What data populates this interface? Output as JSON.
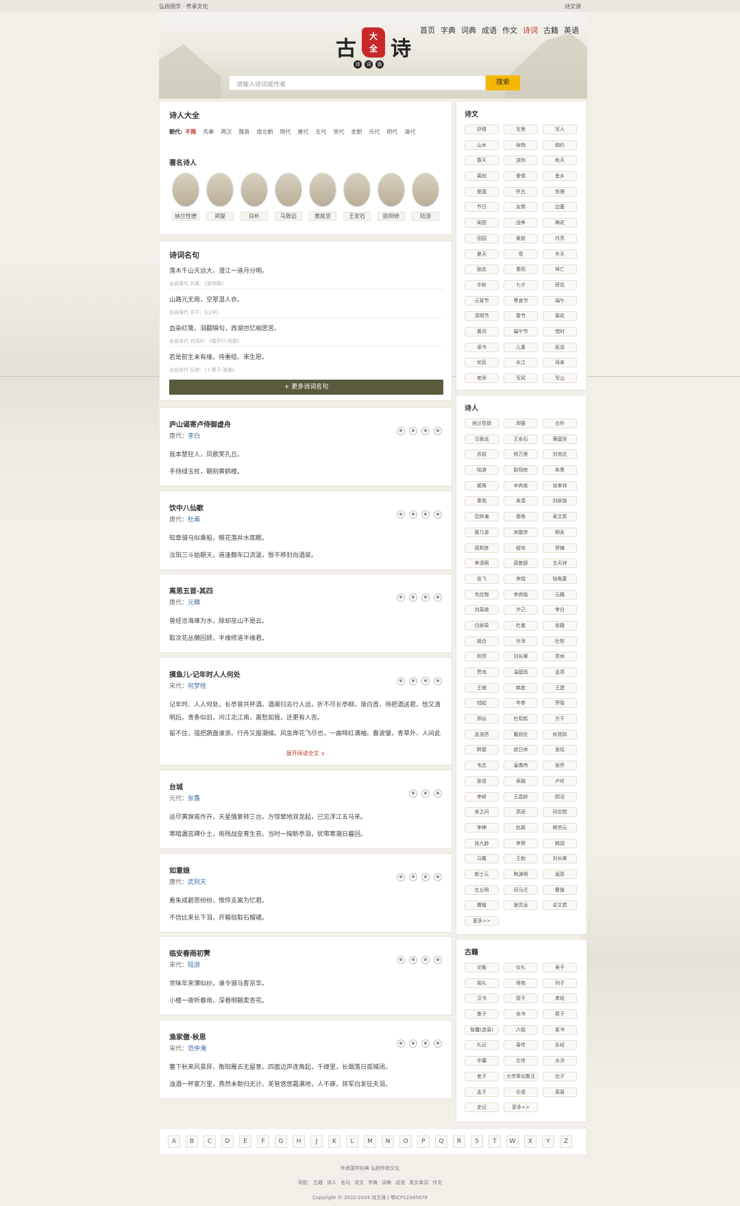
{
  "topbar": {
    "left": "弘扬国学 · 传承文化",
    "right": "诗文驿"
  },
  "nav": [
    "首页",
    "字典",
    "词典",
    "成语",
    "作文",
    "诗词",
    "古籍",
    "英语"
  ],
  "nav_active": 5,
  "logo": {
    "left": "古",
    "right": "诗",
    "seal_top": "大",
    "seal_bottom": "全",
    "sub": [
      "诗",
      "词",
      "曲"
    ]
  },
  "search": {
    "placeholder": "请输入诗词或作者",
    "button": "搜索"
  },
  "poets_card": {
    "title": "诗人大全",
    "dynasty_label": "朝代:",
    "dynasties": [
      "不限",
      "先秦",
      "两汉",
      "魏晋",
      "南北朝",
      "隋代",
      "唐代",
      "五代",
      "宋代",
      "金朝",
      "元代",
      "明代",
      "清代"
    ],
    "famous_title": "著名诗人",
    "famous": [
      "纳兰性德",
      "郑燮",
      "白朴",
      "马致远",
      "黄庭坚",
      "王安石",
      "欧阳修",
      "陆游"
    ]
  },
  "quotes_card": {
    "title": "诗词名句",
    "items": [
      {
        "text": "落木千山天远大，澄江一道月分明。",
        "source": "出自唐代 刘禹：《登快阁》"
      },
      {
        "text": "山路元无雨，空翠湿人衣。",
        "source": "出自唐代 方干：《山中》"
      },
      {
        "text": "血染红笺，泪翻锦句，西湖岂忆相思苦。",
        "source": "出自宋代 刘鸿孙：《踏莎行·闲游》"
      },
      {
        "text": "若是前生未有缘，待重结、来生愿。",
        "source": "出自宋代 乐婉：《卜算子·答施》"
      }
    ],
    "more": "+ 更多诗词名句"
  },
  "poems": [
    {
      "title": "庐山谣寄卢侍御虚舟",
      "dynasty": "唐代：",
      "author": "李白",
      "lines": [
        "我本楚狂人，凤歌笑孔丘。",
        "手持绿玉杖，朝别黄鹤楼。"
      ]
    },
    {
      "title": "饮中八仙歌",
      "dynasty": "唐代：",
      "author": "杜甫",
      "lines": [
        "知章骑马似乘船，眼花落井水底眠。",
        "汝阳三斗始朝天，道逢麴车口流涎，恨不移封向酒泉。"
      ]
    },
    {
      "title": "离思五首·其四",
      "dynasty": "唐代：",
      "author": "元稹",
      "lines": [
        "曾经沧海难为水，除却巫山不是云。",
        "取次花丛懒回顾，半缘修道半缘君。"
      ]
    },
    {
      "title": "摸鱼儿·记年时人人何处",
      "dynasty": "宋代：",
      "author": "何梦桂",
      "lines": [
        "记年时、人人何处，长亭曾共杯酒。酒阑归去行人远，折不尽长亭柳。渐白首，待把酒送君，恰又清明后。青条似旧，问江北江南，离愁如我，还更有人否。",
        "留不住，强把蔬盘谁浙。行舟又报潮候。风急岸花飞尽也，一曲啼红满袖。春波皱，青草外、人间此"
      ],
      "unfold": "展开阅读全文 ∨"
    },
    {
      "title": "台城",
      "dynasty": "元代：",
      "author": "张翥",
      "lines": [
        "运尽黄旗竟作开，天星俄复转三台。方惊辇地双龙起，已见浮江五马来。",
        "寒暗漏宫碑仆土，雨残战垒育生苔。当时一掬新亭泪，犹带寒潮日暮回。"
      ]
    },
    {
      "title": "如意娘",
      "dynasty": "唐代：",
      "author": "武则天",
      "lines": [
        "看朱成碧思纷纷，憔悴支离为忆君。",
        "不信比来长下泪，开箱验取石榴裙。"
      ]
    },
    {
      "title": "临安春雨初霁",
      "dynasty": "宋代：",
      "author": "陆游",
      "lines": [
        "世味年来薄似纱，谁令骑马客京华。",
        "小楼一夜听春雨，深巷明朝卖杏花。"
      ]
    },
    {
      "title": "渔家傲·秋思",
      "dynasty": "宋代：",
      "author": "范仲淹",
      "lines": [
        "塞下秋来风景异，衡阳雁去无留意。四面边声连角起，千嶂里，长烟落日孤城闭。",
        "浊酒一杯家万里，燕然未勒归无计。羌管悠悠霜满地，人不寐，将军白发征夫泪。"
      ]
    }
  ],
  "shiwen": {
    "title": "诗文",
    "tags": [
      "抒情",
      "写景",
      "写人",
      "山水",
      "咏物",
      "婉约",
      "春天",
      "送别",
      "秋天",
      "离别",
      "爱情",
      "思乡",
      "爱国",
      "怀古",
      "哲理",
      "节日",
      "友情",
      "边塞",
      "闺怨",
      "战争",
      "梅花",
      "田园",
      "豪放",
      "月亮",
      "夏天",
      "雪",
      "冬天",
      "励志",
      "重阳",
      "悼亡",
      "中秋",
      "七夕",
      "荷花",
      "元宵节",
      "寒食节",
      "端午",
      "清明节",
      "春节",
      "菊花",
      "黄河",
      "端午节",
      "惜时",
      "读书",
      "儿童",
      "民谣",
      "忧民",
      "长江",
      "母亲",
      "老师",
      "写风",
      "写山"
    ]
  },
  "shiren": {
    "title": "诗人",
    "tags": [
      "纳兰性德",
      "郑燮",
      "白朴",
      "马致远",
      "王安石",
      "黄庭坚",
      "苏轼",
      "杨万里",
      "刘克庄",
      "陆游",
      "欧阳修",
      "朱熹",
      "晏殊",
      "辛弃疾",
      "张孝祥",
      "秦观",
      "吴潜",
      "刘辰翁",
      "范仲淹",
      "晏殊",
      "吴文英",
      "晏几道",
      "宋徽宗",
      "柳永",
      "周邦彦",
      "程垓",
      "贺铸",
      "李清照",
      "周敦颐",
      "文天祥",
      "岳飞",
      "李煜",
      "陆龟蒙",
      "韦应物",
      "李商隐",
      "元稹",
      "刘禹锡",
      "齐己",
      "李白",
      "白居易",
      "杜甫",
      "张籍",
      "姚合",
      "许浑",
      "杜牧",
      "皎然",
      "刘长卿",
      "贯休",
      "贾岛",
      "温庭筠",
      "孟郊",
      "王维",
      "韩愈",
      "王建",
      "钱起",
      "岑参",
      "罗隐",
      "郑谷",
      "杜荀鹤",
      "方干",
      "孟浩然",
      "戴叔伦",
      "权德舆",
      "韩偓",
      "皮日休",
      "张祜",
      "韦庄",
      "皇甫冉",
      "张乔",
      "张说",
      "吴融",
      "卢纶",
      "李峤",
      "王昌龄",
      "顾况",
      "宋之问",
      "高适",
      "司空图",
      "李绅",
      "赵嘏",
      "柳宗元",
      "张九龄",
      "李贺",
      "韩翃",
      "马戴",
      "王勃",
      "刘长卿",
      "郎士元",
      "陶渊明",
      "屈原",
      "左丘明",
      "司马迁",
      "曹操",
      "曹植",
      "谢灵运",
      "卓文君",
      "更多>>"
    ]
  },
  "guji": {
    "title": "古籍",
    "tags": [
      "论衡",
      "仪礼",
      "吴子",
      "周礼",
      "将苑",
      "列子",
      "汉书",
      "管子",
      "孝经",
      "墨子",
      "尚书",
      "荀子",
      "智囊(选录)",
      "六韬",
      "素书",
      "礼记",
      "易传",
      "反经",
      "中庸",
      "左传",
      "水浒",
      "老子",
      "大学章句集注",
      "庄子",
      "孟子",
      "论语",
      "周易",
      "史记",
      "更多>>"
    ]
  },
  "az": [
    "A",
    "B",
    "C",
    "D",
    "E",
    "F",
    "G",
    "H",
    "J",
    "K",
    "L",
    "M",
    "N",
    "O",
    "P",
    "Q",
    "R",
    "S",
    "T",
    "W",
    "X",
    "Y",
    "Z"
  ],
  "footer": {
    "line1": "传承国学经典 弘扬传统文化",
    "nav_label": "导航:",
    "nav": [
      "古籍",
      "诗人",
      "名句",
      "诗文",
      "字典",
      "词典",
      "成语",
      "英文单词",
      "作文"
    ],
    "copyright": "Copyright © 2022-2024 诗文驿 | 鄂ICP12345678"
  }
}
